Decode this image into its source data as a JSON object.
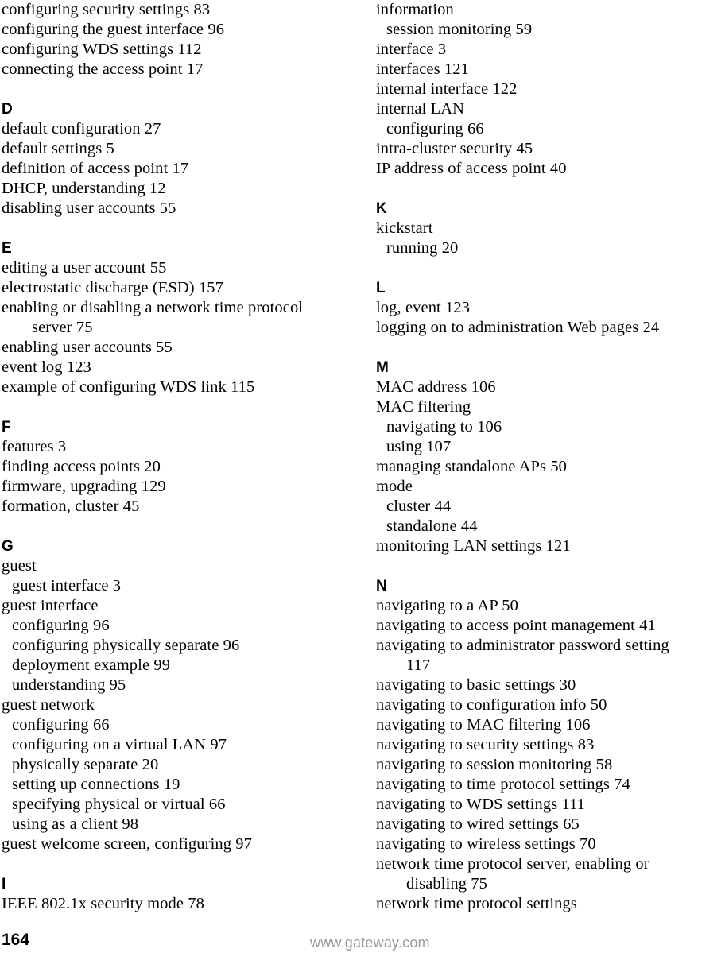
{
  "document": {
    "type": "index",
    "page_number": "164",
    "site_url": "www.gateway.com"
  },
  "colors": {
    "text": "#000000",
    "background": "#ffffff",
    "footer_url": "#9a9a9a"
  },
  "columns": {
    "left": [
      {
        "kind": "entry",
        "text": "configuring security settings 83"
      },
      {
        "kind": "entry",
        "text": "configuring the guest interface 96"
      },
      {
        "kind": "entry",
        "text": "configuring WDS settings 112"
      },
      {
        "kind": "entry",
        "text": "connecting the access point 17"
      },
      {
        "kind": "letter",
        "text": "D"
      },
      {
        "kind": "entry",
        "text": "default configuration 27"
      },
      {
        "kind": "entry",
        "text": "default settings 5"
      },
      {
        "kind": "entry",
        "text": "definition of access point 17"
      },
      {
        "kind": "entry",
        "text": "DHCP, understanding 12"
      },
      {
        "kind": "entry",
        "text": "disabling user accounts 55"
      },
      {
        "kind": "letter",
        "text": "E"
      },
      {
        "kind": "entry",
        "text": "editing a user account 55"
      },
      {
        "kind": "entry",
        "text": "electrostatic discharge (ESD) 157"
      },
      {
        "kind": "entry",
        "text": "enabling or disabling a network time protocol"
      },
      {
        "kind": "cont",
        "text": "server 75"
      },
      {
        "kind": "entry",
        "text": "enabling user accounts 55"
      },
      {
        "kind": "entry",
        "text": "event log 123"
      },
      {
        "kind": "entry",
        "text": "example of configuring WDS link 115"
      },
      {
        "kind": "letter",
        "text": "F"
      },
      {
        "kind": "entry",
        "text": "features 3"
      },
      {
        "kind": "entry",
        "text": "finding access points 20"
      },
      {
        "kind": "entry",
        "text": "firmware, upgrading 129"
      },
      {
        "kind": "entry",
        "text": "formation, cluster 45"
      },
      {
        "kind": "letter",
        "text": "G"
      },
      {
        "kind": "entry",
        "text": "guest"
      },
      {
        "kind": "sub",
        "text": "guest interface 3"
      },
      {
        "kind": "entry",
        "text": "guest interface"
      },
      {
        "kind": "sub",
        "text": "configuring 96"
      },
      {
        "kind": "sub",
        "text": "configuring physically separate 96"
      },
      {
        "kind": "sub",
        "text": "deployment example 99"
      },
      {
        "kind": "sub",
        "text": "understanding 95"
      },
      {
        "kind": "entry",
        "text": "guest network"
      },
      {
        "kind": "sub",
        "text": "configuring 66"
      },
      {
        "kind": "sub",
        "text": "configuring on a virtual LAN 97"
      },
      {
        "kind": "sub",
        "text": "physically separate 20"
      },
      {
        "kind": "sub",
        "text": "setting up connections 19"
      },
      {
        "kind": "sub",
        "text": "specifying physical or virtual 66"
      },
      {
        "kind": "sub",
        "text": "using as a client 98"
      },
      {
        "kind": "entry",
        "text": "guest welcome screen, configuring 97"
      },
      {
        "kind": "letter",
        "text": "I"
      },
      {
        "kind": "entry",
        "text": "IEEE 802.1x security mode 78"
      }
    ],
    "right": [
      {
        "kind": "entry",
        "text": "information"
      },
      {
        "kind": "sub",
        "text": "session monitoring 59"
      },
      {
        "kind": "entry",
        "text": "interface 3"
      },
      {
        "kind": "entry",
        "text": "interfaces 121"
      },
      {
        "kind": "entry",
        "text": "internal interface 122"
      },
      {
        "kind": "entry",
        "text": "internal LAN"
      },
      {
        "kind": "sub",
        "text": "configuring 66"
      },
      {
        "kind": "entry",
        "text": "intra-cluster security 45"
      },
      {
        "kind": "entry",
        "text": "IP address of access point 40"
      },
      {
        "kind": "letter",
        "text": "K"
      },
      {
        "kind": "entry",
        "text": "kickstart"
      },
      {
        "kind": "sub",
        "text": "running 20"
      },
      {
        "kind": "letter",
        "text": "L"
      },
      {
        "kind": "entry",
        "text": "log, event 123"
      },
      {
        "kind": "entry",
        "text": "logging on to administration Web pages 24"
      },
      {
        "kind": "letter",
        "text": "M"
      },
      {
        "kind": "entry",
        "text": "MAC address 106"
      },
      {
        "kind": "entry",
        "text": "MAC filtering"
      },
      {
        "kind": "sub",
        "text": "navigating to 106"
      },
      {
        "kind": "sub",
        "text": "using 107"
      },
      {
        "kind": "entry",
        "text": "managing standalone APs 50"
      },
      {
        "kind": "entry",
        "text": "mode"
      },
      {
        "kind": "sub",
        "text": "cluster 44"
      },
      {
        "kind": "sub",
        "text": "standalone 44"
      },
      {
        "kind": "entry",
        "text": "monitoring LAN settings 121"
      },
      {
        "kind": "letter",
        "text": "N"
      },
      {
        "kind": "entry",
        "text": "navigating to a AP 50"
      },
      {
        "kind": "entry",
        "text": "navigating to access point management 41"
      },
      {
        "kind": "entry",
        "text": "navigating to administrator password setting"
      },
      {
        "kind": "cont",
        "text": "117"
      },
      {
        "kind": "entry",
        "text": "navigating to basic settings 30"
      },
      {
        "kind": "entry",
        "text": "navigating to configuration info 50"
      },
      {
        "kind": "entry",
        "text": "navigating to MAC filtering 106"
      },
      {
        "kind": "entry",
        "text": "navigating to security settings 83"
      },
      {
        "kind": "entry",
        "text": "navigating to session monitoring 58"
      },
      {
        "kind": "entry",
        "text": "navigating to time protocol settings 74"
      },
      {
        "kind": "entry",
        "text": "navigating to WDS settings 111"
      },
      {
        "kind": "entry",
        "text": "navigating to wired settings 65"
      },
      {
        "kind": "entry",
        "text": "navigating to wireless settings 70"
      },
      {
        "kind": "entry",
        "text": "network time protocol server, enabling or"
      },
      {
        "kind": "cont",
        "text": "disabling 75"
      },
      {
        "kind": "entry",
        "text": "network time protocol settings"
      }
    ]
  }
}
